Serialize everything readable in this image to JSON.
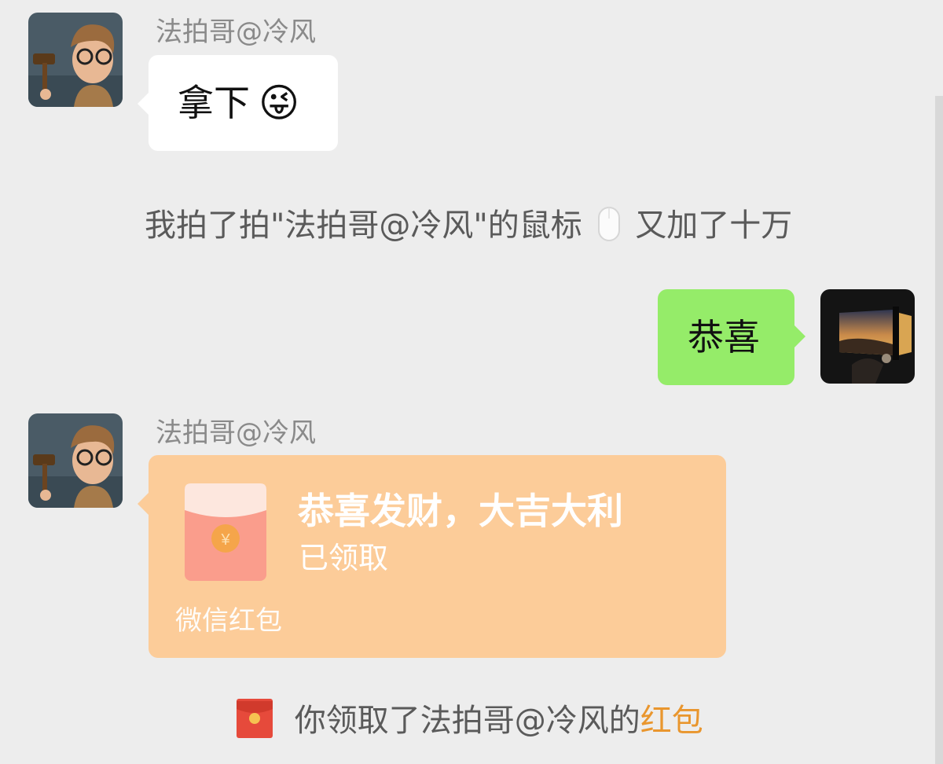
{
  "messages": {
    "m1": {
      "sender": "法拍哥@冷风",
      "text": "拿下",
      "emoji": "😜"
    },
    "system1": {
      "prefix": "我拍了拍\"法拍哥@冷风\"的鼠标",
      "suffix": "又加了十万"
    },
    "m2": {
      "text": "恭喜"
    },
    "m3": {
      "sender": "法拍哥@冷风",
      "hongbao_title": "恭喜发财，大吉大利",
      "hongbao_status": "已领取",
      "hongbao_footer": "微信红包",
      "yuan_symbol": "¥"
    },
    "system2": {
      "prefix": "你领取了法拍哥@冷风的",
      "link": "红包"
    }
  },
  "colors": {
    "background": "#ededed",
    "bubble_incoming": "#ffffff",
    "bubble_outgoing": "#95ec69",
    "hongbao_opened": "#fccc99",
    "red_link": "#e9962e"
  },
  "icons": [
    "avatar-cartoon-gavel",
    "avatar-car-window-sunset",
    "mouse-icon",
    "red-envelope-icon",
    "red-envelope-small-icon"
  ]
}
